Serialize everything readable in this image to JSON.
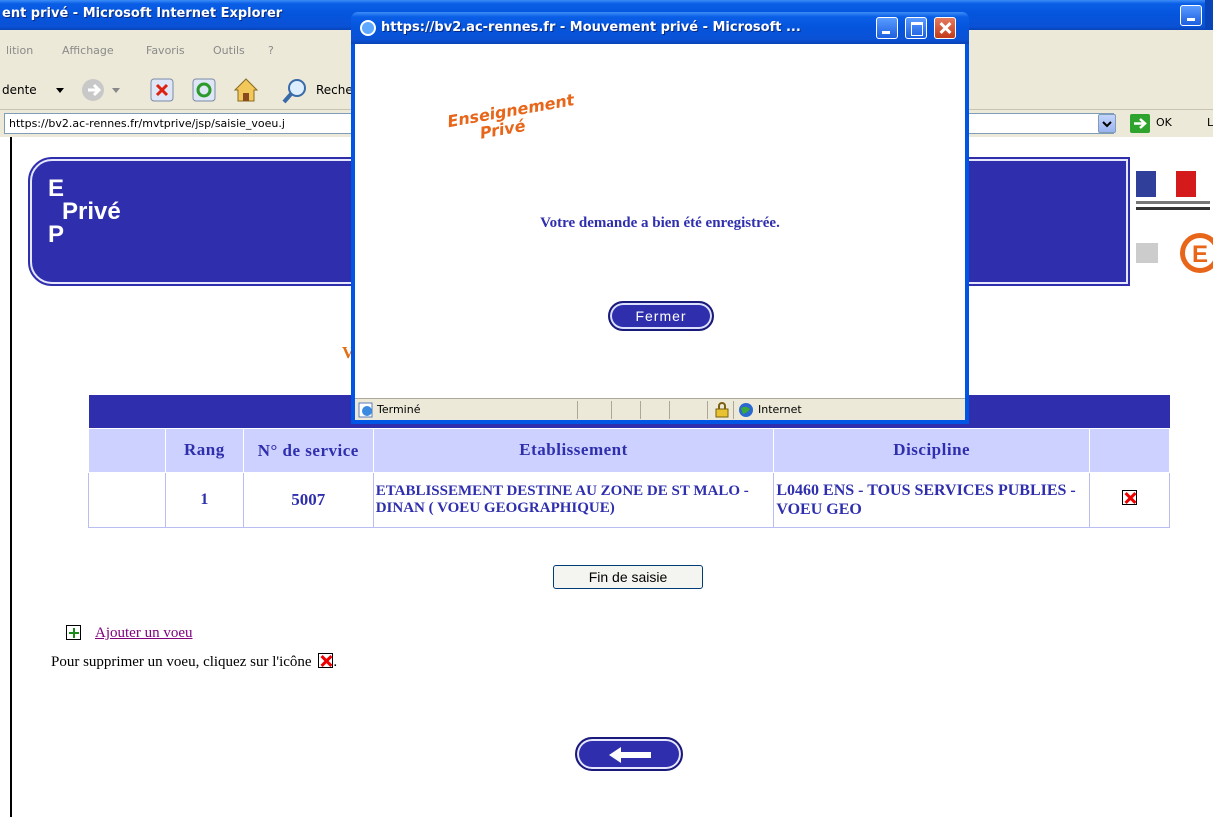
{
  "main_window": {
    "title": "ent privé - Microsoft Internet Explorer",
    "menu": [
      "lition",
      "Affichage",
      "Favoris",
      "Outils",
      "?"
    ],
    "toolbar": {
      "back_label": "dente",
      "search_label": "Reche"
    },
    "address": "https://bv2.ac-rennes.fr/mvtprive/jsp/saisie_voeu.j",
    "go_label": "OK"
  },
  "banner": {
    "logo_lines": [
      "E",
      "Privé",
      "P"
    ]
  },
  "page": {
    "partial_heading": "V",
    "table": {
      "headers": [
        "",
        "Rang",
        "N° de service",
        "Etablissement",
        "Discipline",
        ""
      ],
      "rows": [
        {
          "rang": "1",
          "service": "5007",
          "etablissement": "ETABLISSEMENT DESTINE AU ZONE DE ST MALO - DINAN ( VOEU GEOGRAPHIQUE)",
          "discipline": "L0460 ENS - TOUS SERVICES PUBLIES - VOEU GEO"
        }
      ]
    },
    "fin_button": "Fin de saisie",
    "add_link": "Ajouter un voeu",
    "help_text": "Pour supprimer un voeu, cliquez sur l'icône",
    "help_suffix": "."
  },
  "popup": {
    "title": "https://bv2.ac-rennes.fr - Mouvement privé - Microsoft ...",
    "logo": [
      "Enseignement",
      "Privé"
    ],
    "message": "Votre demande a bien été enregistrée.",
    "close_button": "Fermer",
    "status_text": "Terminé",
    "zone": "Internet"
  }
}
